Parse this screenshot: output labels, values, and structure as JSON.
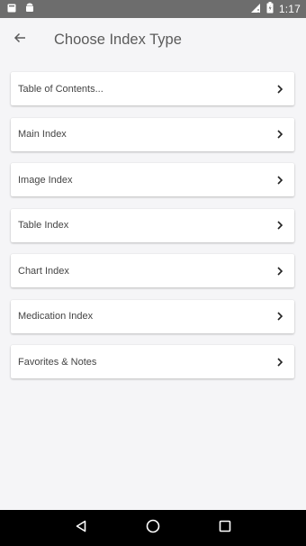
{
  "status_bar": {
    "time": "1:17",
    "icons": [
      "notification-icon",
      "android-icon",
      "signal-icon",
      "battery-icon"
    ]
  },
  "header": {
    "title": "Choose Index Type",
    "back_icon": "arrow-back-icon"
  },
  "index_types": [
    {
      "label": "Table of Contents..."
    },
    {
      "label": "Main Index"
    },
    {
      "label": "Image Index"
    },
    {
      "label": "Table Index"
    },
    {
      "label": "Chart Index"
    },
    {
      "label": "Medication Index"
    },
    {
      "label": "Favorites & Notes"
    }
  ],
  "nav_bar": {
    "buttons": [
      "back-triangle-icon",
      "home-circle-icon",
      "recents-square-icon"
    ]
  },
  "colors": {
    "status_bar": "#6d6d6d",
    "background": "#f5f5f7",
    "card": "#ffffff",
    "nav_bar": "#000000",
    "title_text": "#5b5b5b"
  }
}
